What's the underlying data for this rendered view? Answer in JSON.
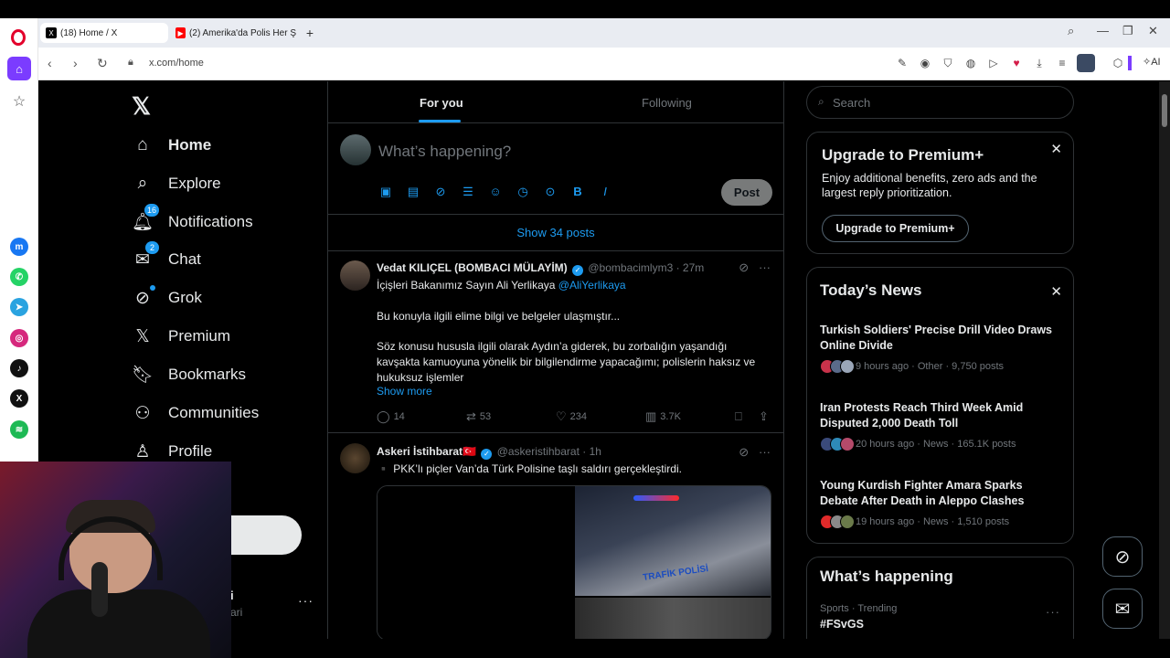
{
  "browser": {
    "tabs": [
      {
        "title": "(18) Home / X",
        "active": true,
        "favicon": "x-icon"
      },
      {
        "title": "(2) Amerika'da Polis Her Ş",
        "active": false,
        "favicon": "youtube-icon"
      }
    ],
    "new_tab": "+",
    "url": "x.com/home",
    "ai_label": "AI"
  },
  "nav": {
    "items": [
      {
        "label": "Home",
        "icon": "home-icon",
        "badge": null
      },
      {
        "label": "Explore",
        "icon": "search-icon",
        "badge": null
      },
      {
        "label": "Notifications",
        "icon": "bell-icon",
        "badge": "16"
      },
      {
        "label": "Chat",
        "icon": "mail-icon",
        "badge": "2"
      },
      {
        "label": "Grok",
        "icon": "grok-icon",
        "badge": null
      },
      {
        "label": "Premium",
        "icon": "x-icon",
        "badge": null
      },
      {
        "label": "Bookmarks",
        "icon": "bookmark-icon",
        "badge": null
      },
      {
        "label": "Communities",
        "icon": "communities-icon",
        "badge": null
      },
      {
        "label": "Profile",
        "icon": "profile-icon",
        "badge": null
      }
    ],
    "account_fragment_1": "i",
    "account_fragment_2": "ari",
    "account_more": "···"
  },
  "feed": {
    "tab_for_you": "For you",
    "tab_following": "Following",
    "compose_placeholder": "What’s happening?",
    "post_button": "Post",
    "show_posts": "Show 34 posts",
    "tweets": [
      {
        "name": "Vedat KILIÇEL (BOMBACI MÜLAYİM)",
        "handle": "@bombacimlym3",
        "time": "· 27m",
        "line1_prefix": "İçişleri Bakanımız Sayın Ali Yerlikaya",
        "line1_mention": "@AliYerlikaya",
        "para2": "Bu konuyla ilgili elime bilgi ve belgeler ulaşmıştır...",
        "para3": "Söz konusu hususla ilgili olarak Aydın’a giderek, bu zorbalığın yaşandığı kavşakta kamuoyuna yönelik bir bilgilendirme yapacağımı; polislerin haksız ve hukuksuz işlemler",
        "show_more": "Show more",
        "replies": "14",
        "reposts": "53",
        "likes": "234",
        "views": "3.7K"
      },
      {
        "name": "Askeri İstihbarat",
        "flag": "🇹🇷",
        "handle": "@askeristihbarat",
        "time": "· 1h",
        "text": "▪️ PKK’lı piçler Van’da Türk Polisine taşlı saldırı gerçekleştirdi.",
        "media_text": "TRAFİK POLİSİ"
      }
    ]
  },
  "sidebar": {
    "search_placeholder": "Search",
    "premium": {
      "title": "Upgrade to Premium+",
      "text": "Enjoy additional benefits, zero ads and the largest reply prioritization.",
      "button": "Upgrade to Premium+"
    },
    "news": {
      "title": "Today’s News",
      "items": [
        {
          "headline": "Turkish Soldiers' Precise Drill Video Draws Online Divide",
          "meta": "9 hours ago · Other · 9,750 posts"
        },
        {
          "headline": "Iran Protests Reach Third Week Amid Disputed 2,000 Death Toll",
          "meta": "20 hours ago · News · 165.1K posts"
        },
        {
          "headline": "Young Kurdish Fighter Amara Sparks Debate After Death in Aleppo Clashes",
          "meta": "19 hours ago · News · 1,510 posts"
        }
      ]
    },
    "happening": {
      "title": "What’s happening",
      "category": "Sports · Trending",
      "trend": "#FSvGS"
    }
  },
  "colors": {
    "accent": "#1d9bf0",
    "background": "#000000",
    "border": "#2f3336",
    "text": "#e7e9ea",
    "muted": "#71767b",
    "opera_red": "#e3002b"
  }
}
